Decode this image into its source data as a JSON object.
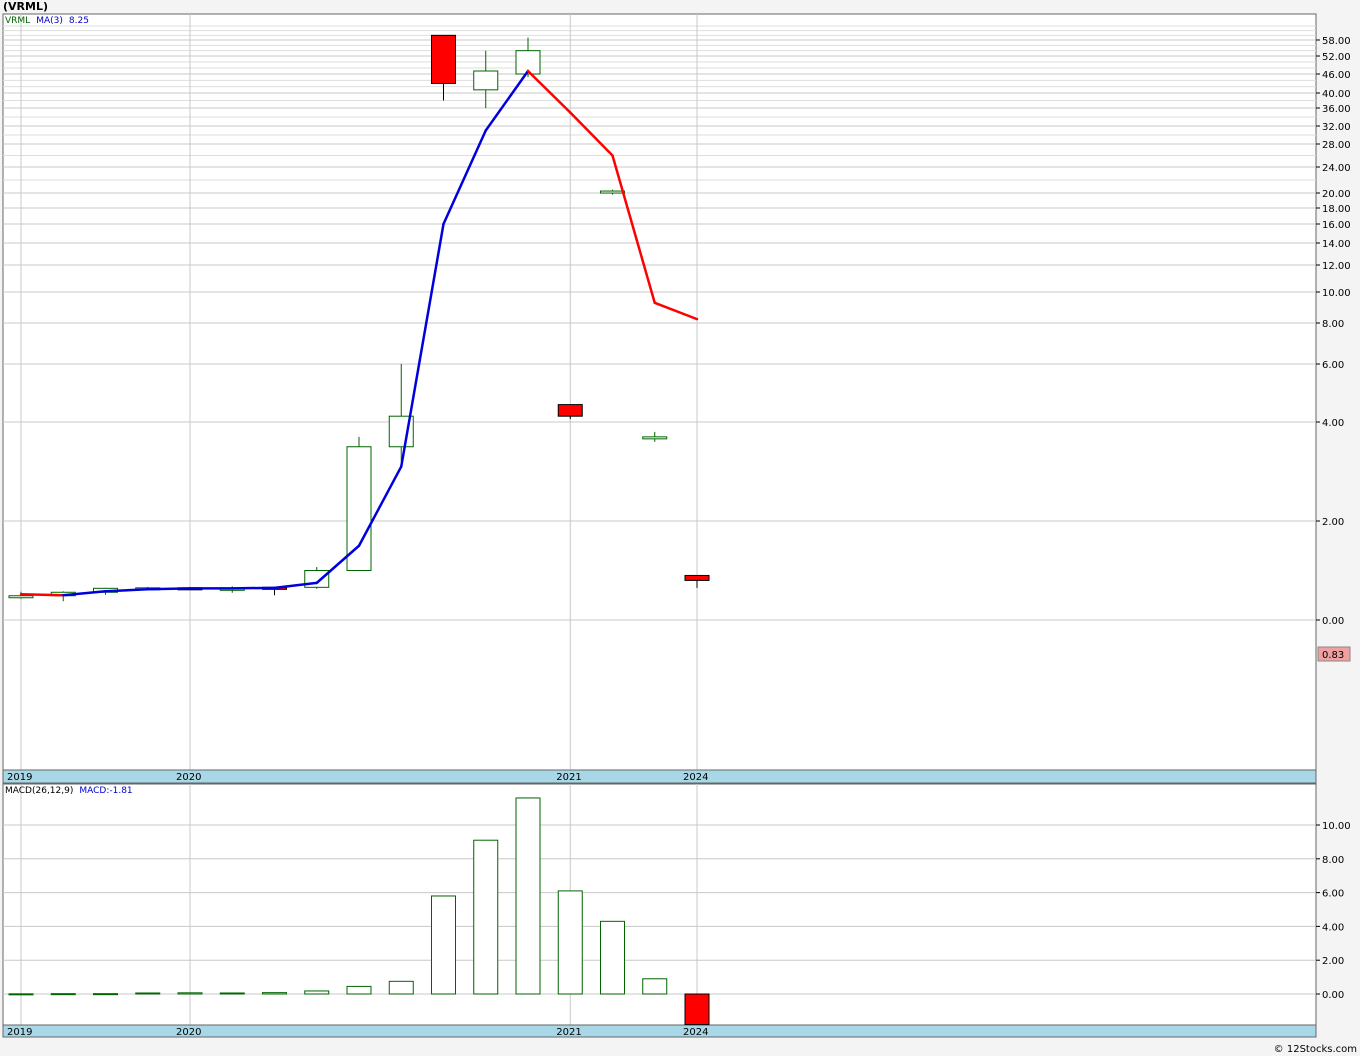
{
  "title": "(VRML)",
  "price_panel": {
    "legend": {
      "symbol": "VRML",
      "ma_label": "MA(3)",
      "ma_value": "8.25"
    },
    "last_price_tag": "0.83",
    "y_tick_labels": [
      "58.00",
      "52.00",
      "46.00",
      "40.00",
      "36.00",
      "32.00",
      "28.00",
      "24.00",
      "20.00",
      "18.00",
      "16.00",
      "14.00",
      "12.00",
      "10.00",
      "8.00",
      "6.00",
      "4.00",
      "2.00",
      "0.00"
    ]
  },
  "macd_panel": {
    "legend": {
      "label": "MACD(26,12,9)",
      "value_label": "MACD:-1.81"
    },
    "y_tick_labels": [
      "10.00",
      "8.00",
      "6.00",
      "4.00",
      "2.00",
      "0.00"
    ]
  },
  "x_axis_labels": [
    "2019",
    "2020",
    "2021",
    "2024"
  ],
  "watermark": "© 12Stocks.com",
  "colors": {
    "up": "#006400",
    "down": "#ff0000",
    "ma_up": "#0000dd",
    "ma_down": "#ff0000",
    "grid": "#c8c8c8",
    "axis_band": "#a8d8e8",
    "price_tag_bg": "#f0a0a0"
  },
  "chart_data": [
    {
      "type": "candlestick",
      "scale": "log-like",
      "series": [
        {
          "name": "VRML",
          "ohlc": [
            {
              "o": 0.48,
              "h": 0.57,
              "l": 0.43,
              "c": 0.49
            },
            {
              "o": 0.49,
              "h": 0.58,
              "l": 0.38,
              "c": 0.56
            },
            {
              "o": 0.56,
              "h": 0.65,
              "l": 0.51,
              "c": 0.64
            },
            {
              "o": 0.64,
              "h": 0.67,
              "l": 0.62,
              "c": 0.65
            },
            {
              "o": 0.65,
              "h": 0.66,
              "l": 0.63,
              "c": 0.64
            },
            {
              "o": 0.63,
              "h": 0.68,
              "l": 0.55,
              "c": 0.64
            },
            {
              "o": 0.66,
              "h": 0.67,
              "l": 0.5,
              "c": 0.65
            },
            {
              "o": 0.66,
              "h": 1.07,
              "l": 0.63,
              "c": 1.0
            },
            {
              "o": 1.0,
              "h": 3.7,
              "l": 1.6,
              "c": 3.5
            },
            {
              "o": 3.5,
              "h": 6.0,
              "l": 3.2,
              "c": 4.2
            },
            {
              "o": 60,
              "h": 60,
              "l": 38,
              "c": 43
            },
            {
              "o": 41,
              "h": 54,
              "l": 36,
              "c": 47
            },
            {
              "o": 46,
              "h": 59,
              "l": 45,
              "c": 54
            },
            {
              "o": 4.6,
              "h": 4.6,
              "l": 4.1,
              "c": 4.2
            },
            {
              "o": 20.1,
              "h": 20.5,
              "l": 19.8,
              "c": 20.3
            },
            {
              "o": 3.7,
              "h": 3.8,
              "l": 3.6,
              "c": 3.7
            },
            {
              "o": 0.9,
              "h": 0.9,
              "l": 0.65,
              "c": 0.8
            }
          ]
        },
        {
          "name": "MA(3)",
          "values": [
            0.52,
            0.5,
            0.58,
            0.62,
            0.64,
            0.64,
            0.65,
            0.75,
            1.5,
            3.1,
            16,
            31,
            47,
            35,
            26,
            9.3,
            8.25
          ]
        }
      ],
      "x_labels": [
        "2019",
        "2020",
        "2021",
        "2024"
      ]
    },
    {
      "type": "bar",
      "series": [
        {
          "name": "MACD",
          "values": [
            0.01,
            0.02,
            0.02,
            0.06,
            0.07,
            0.06,
            0.08,
            0.18,
            0.45,
            0.75,
            5.8,
            9.1,
            11.6,
            6.1,
            4.3,
            0.9,
            -1.81
          ]
        }
      ],
      "ylim": [
        -2,
        12
      ]
    }
  ]
}
